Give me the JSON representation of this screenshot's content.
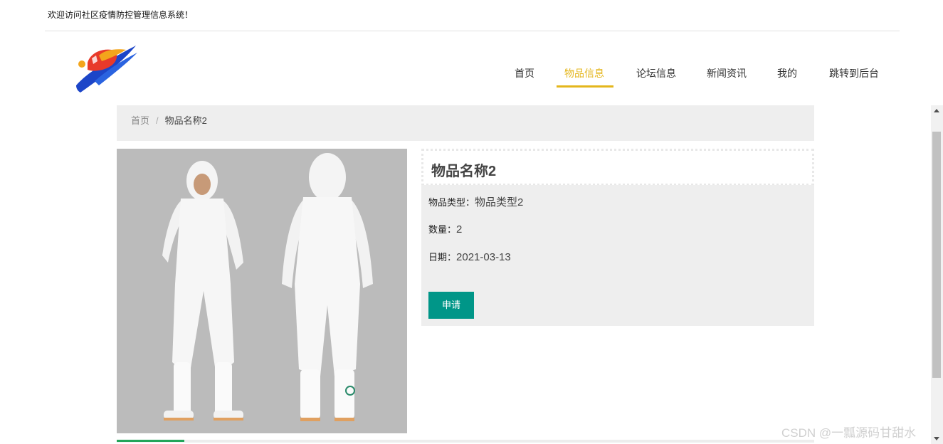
{
  "header": {
    "welcome": "欢迎访问社区疫情防控管理信息系统！"
  },
  "logo": {
    "icon": "swoosh-logo-icon"
  },
  "nav": {
    "items": [
      {
        "label": "首页",
        "active": false
      },
      {
        "label": "物品信息",
        "active": true
      },
      {
        "label": "论坛信息",
        "active": false
      },
      {
        "label": "新闻资讯",
        "active": false
      },
      {
        "label": "我的",
        "active": false
      },
      {
        "label": "跳转到后台",
        "active": false
      }
    ],
    "accent_color": "#e4b61c"
  },
  "breadcrumb": {
    "home": "首页",
    "separator": "/",
    "current": "物品名称2"
  },
  "item": {
    "title": "物品名称2",
    "type_label": "物品类型：",
    "type_value": "物品类型2",
    "quantity_label": "数量：",
    "quantity_value": "2",
    "date_label": "日期：",
    "date_value": "2021-03-13",
    "apply_button": "申请",
    "image": "protective-suit-photo"
  },
  "colors": {
    "primary_button": "#009688",
    "panel_bg": "#eeeeee"
  },
  "watermark": "CSDN @一瓢源码甘甜水"
}
